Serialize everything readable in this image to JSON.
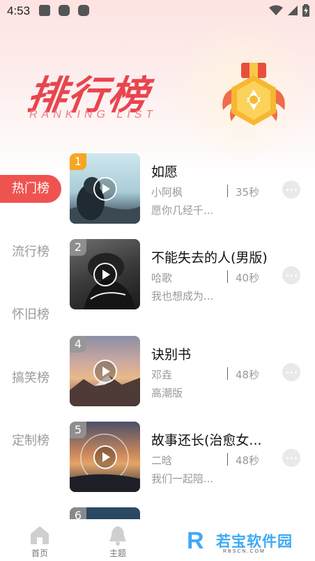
{
  "status_bar": {
    "time": "4:53"
  },
  "header": {
    "title": "排行榜",
    "subtitle": "RANKING LIST"
  },
  "sidebar": {
    "items": [
      {
        "label": "热门榜",
        "active": true
      },
      {
        "label": "流行榜",
        "active": false
      },
      {
        "label": "怀旧榜",
        "active": false
      },
      {
        "label": "搞笑榜",
        "active": false
      },
      {
        "label": "定制榜",
        "active": false
      }
    ]
  },
  "songs": [
    {
      "rank": "1",
      "title": "如愿",
      "artist": "小阿枫",
      "duration": "35秒",
      "desc": "愿你几经千..."
    },
    {
      "rank": "2",
      "title": "不能失去的人(男版)",
      "artist": "哈歌",
      "duration": "40秒",
      "desc": "我也想成为..."
    },
    {
      "rank": "4",
      "title": "诀别书",
      "artist": "邓垚",
      "duration": "48秒",
      "desc": "高潮版"
    },
    {
      "rank": "5",
      "title": "故事还长(治愈女...",
      "artist": "二晗",
      "duration": "48秒",
      "desc": "我们一起陪..."
    },
    {
      "rank": "6"
    }
  ],
  "bottom_nav": {
    "items": [
      {
        "label": "首页",
        "icon": "home-icon"
      },
      {
        "label": "主题",
        "icon": "bell-icon"
      }
    ]
  },
  "watermark": {
    "letter": "R",
    "text": "若宝软件园",
    "url": "RBSCN.COM"
  },
  "colors": {
    "accent": "#ef5350",
    "title_red": "#e8454f",
    "rank_gold": "#f5a623"
  }
}
